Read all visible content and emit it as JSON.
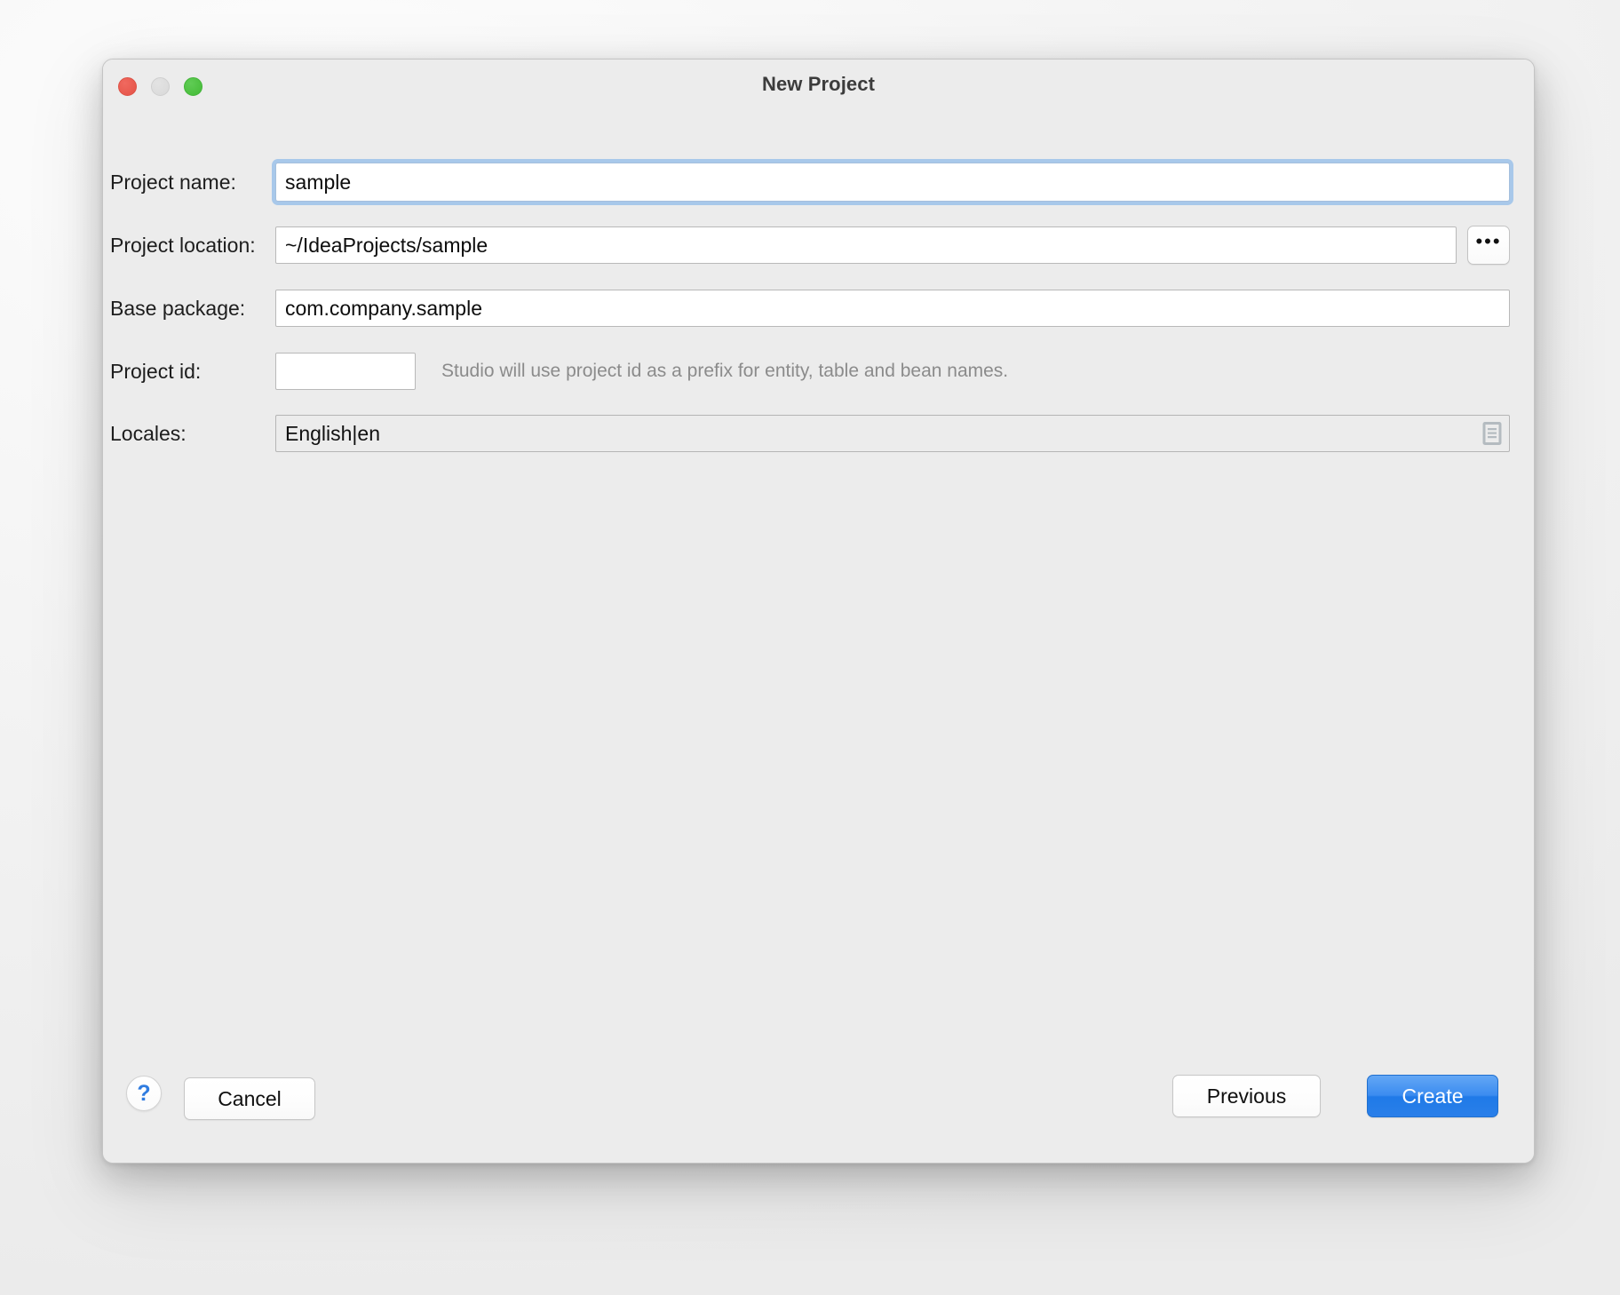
{
  "window": {
    "title": "New Project",
    "traffic_lights": [
      {
        "name": "close-button",
        "color": "#e8594e"
      },
      {
        "name": "minimize-button",
        "color": "#dcdcdc"
      },
      {
        "name": "maximize-button",
        "color": "#4cc03f"
      }
    ]
  },
  "form": {
    "project_name": {
      "label": "Project name:",
      "value": "sample",
      "placeholder": "",
      "focused": true
    },
    "project_location": {
      "label": "Project location:",
      "value": "~/IdeaProjects/sample",
      "placeholder": "",
      "browse_label": "•••"
    },
    "base_package": {
      "label": "Base package:",
      "value": "com.company.sample",
      "placeholder": ""
    },
    "project_id": {
      "label": "Project id:",
      "value": "",
      "placeholder": "",
      "hint": "Studio will use project id as a prefix for entity, table and bean names."
    },
    "locales": {
      "label": "Locales:",
      "value": "English|en",
      "icon": "list-document-icon"
    }
  },
  "footer": {
    "help_label": "?",
    "cancel_label": "Cancel",
    "previous_label": "Previous",
    "create_label": "Create"
  },
  "colors": {
    "accent": "#2a7fe9",
    "focus_ring": "#a8c8ea",
    "dialog_bg": "#ececec",
    "help_blue": "#2f7ce0"
  }
}
